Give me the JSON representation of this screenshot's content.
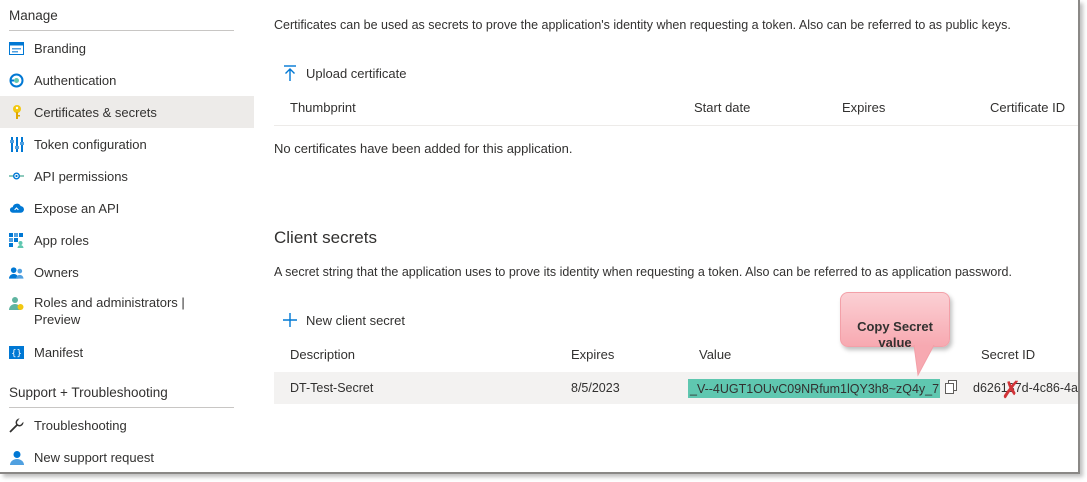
{
  "sidebar": {
    "manage_header": "Manage",
    "support_header": "Support + Troubleshooting",
    "items": [
      {
        "label": "Branding",
        "icon": "branding-icon"
      },
      {
        "label": "Authentication",
        "icon": "authentication-icon"
      },
      {
        "label": "Certificates & secrets",
        "icon": "key-icon"
      },
      {
        "label": "Token configuration",
        "icon": "token-configuration-icon"
      },
      {
        "label": "API permissions",
        "icon": "api-permissions-icon"
      },
      {
        "label": "Expose an API",
        "icon": "cloud-icon"
      },
      {
        "label": "App roles",
        "icon": "app-roles-icon"
      },
      {
        "label": "Owners",
        "icon": "owners-icon"
      },
      {
        "label": "Roles and administrators |\nPreview",
        "icon": "roles-admin-icon"
      },
      {
        "label": "Manifest",
        "icon": "manifest-icon"
      }
    ],
    "support_items": [
      {
        "label": "Troubleshooting",
        "icon": "wrench-icon"
      },
      {
        "label": "New support request",
        "icon": "support-person-icon"
      }
    ]
  },
  "certificates": {
    "description": "Certificates can be used as secrets to prove the application's identity when requesting a token. Also can be referred to as public keys.",
    "upload_label": "Upload certificate",
    "columns": [
      "Thumbprint",
      "Start date",
      "Expires",
      "Certificate ID"
    ],
    "empty_message": "No certificates have been added for this application."
  },
  "client_secrets": {
    "title": "Client secrets",
    "description": "A secret string that the application uses to prove its identity when requesting a token. Also can be referred to as application password.",
    "new_label": "New client secret",
    "columns": [
      "Description",
      "Expires",
      "Value",
      "Secret ID"
    ],
    "rows": [
      {
        "description": "DT-Test-Secret",
        "expires": "8/5/2023",
        "value": "_V--4UGT1OUvC09NRfum1lQY3h8~zQ4y_7",
        "secret_id": "d626137d-4c86-4a"
      }
    ]
  },
  "callout": {
    "text": "Copy Secret\nvalue"
  },
  "colors": {
    "active_bg": "#edebe9",
    "highlight": "#5fc7b0",
    "accent": "#0078d4",
    "callout": "#f7a9b1",
    "x_mark": "#d13438"
  }
}
